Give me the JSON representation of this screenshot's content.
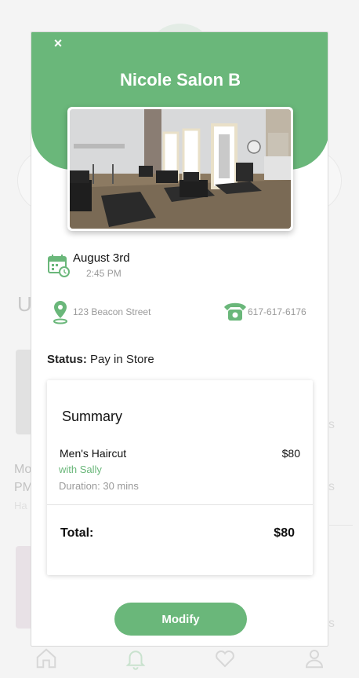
{
  "background": {
    "partial_heading": "U",
    "card1_lines": [
      "Mo",
      "PM",
      "Ha"
    ],
    "right_fragments": [
      "s",
      "s",
      "s",
      "s"
    ]
  },
  "modal": {
    "close_label": "×",
    "salon_name": "Nicole Salon B",
    "appointment": {
      "date": "August 3rd",
      "time": "2:45 PM",
      "address": "123 Beacon Street",
      "phone": "617-617-6176"
    },
    "status": {
      "label": "Status:",
      "value": "Pay in Store"
    },
    "summary": {
      "title": "Summary",
      "service": {
        "name": "Men's Haircut",
        "price": "$80",
        "stylist": "with Sally",
        "duration": "Duration: 30 mins"
      },
      "total_label": "Total:",
      "total_value": "$80"
    },
    "modify_label": "Modify"
  },
  "bottom_nav": {
    "icons": [
      "home-icon",
      "bell-icon",
      "heart-icon",
      "profile-icon"
    ]
  },
  "colors": {
    "accent": "#6ab77a",
    "muted_text": "#9a9a9a"
  }
}
